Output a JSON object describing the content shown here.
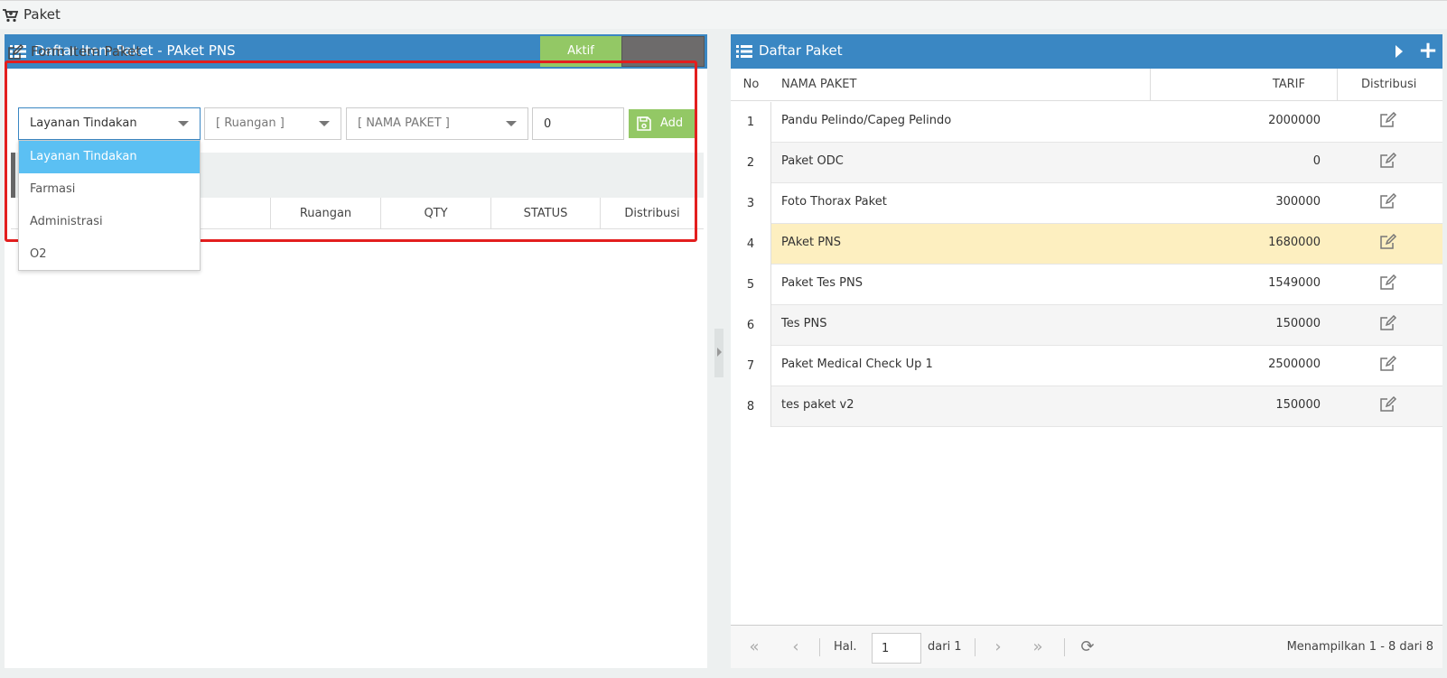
{
  "page": {
    "title": "Paket"
  },
  "left_panel": {
    "title": "Daftar Item Paket - PAket PNS",
    "toggle_on_label": "Aktif",
    "form_title": "Form Item Paket",
    "selects": {
      "jenis": "Layanan Tindakan",
      "ruangan": "[ Ruangan ]",
      "nama_paket": "[ NAMA PAKET ]"
    },
    "qty_value": "0",
    "add_label": "Add",
    "dropdown_options": [
      "Layanan Tindakan",
      "Farmasi",
      "Administrasi",
      "O2"
    ],
    "table_columns": [
      "Ruangan",
      "QTY",
      "STATUS",
      "Distribusi"
    ]
  },
  "right_panel": {
    "title": "Daftar Paket",
    "plus_label": "+",
    "columns": {
      "no": "No",
      "nama": "NAMA PAKET",
      "tarif": "TARIF",
      "distribusi": "Distribusi"
    },
    "rows": [
      {
        "no": "1",
        "nama": "Pandu Pelindo/Capeg Pelindo",
        "tarif": "2000000"
      },
      {
        "no": "2",
        "nama": "Paket ODC",
        "tarif": "0"
      },
      {
        "no": "3",
        "nama": "Foto Thorax Paket",
        "tarif": "300000"
      },
      {
        "no": "4",
        "nama": "PAket PNS",
        "tarif": "1680000"
      },
      {
        "no": "5",
        "nama": "Paket Tes PNS",
        "tarif": "1549000"
      },
      {
        "no": "6",
        "nama": "Tes PNS",
        "tarif": "150000"
      },
      {
        "no": "7",
        "nama": "Paket Medical Check Up 1",
        "tarif": "2500000"
      },
      {
        "no": "8",
        "nama": "tes paket v2",
        "tarif": "150000"
      }
    ],
    "pager": {
      "page_label": "Hal.",
      "page_value": "1",
      "of_label": "dari 1",
      "info": "Menampilkan 1 - 8 dari 8",
      "first": "«",
      "prev": "‹",
      "next": "›",
      "last": "»",
      "refresh": "⟳"
    }
  },
  "colors": {
    "header_blue": "#3a87c3",
    "green": "#93c865",
    "highlight_row": "#fdefc0",
    "dropdown_selected": "#5bc0f3",
    "annotation_red": "#e31e1e"
  }
}
